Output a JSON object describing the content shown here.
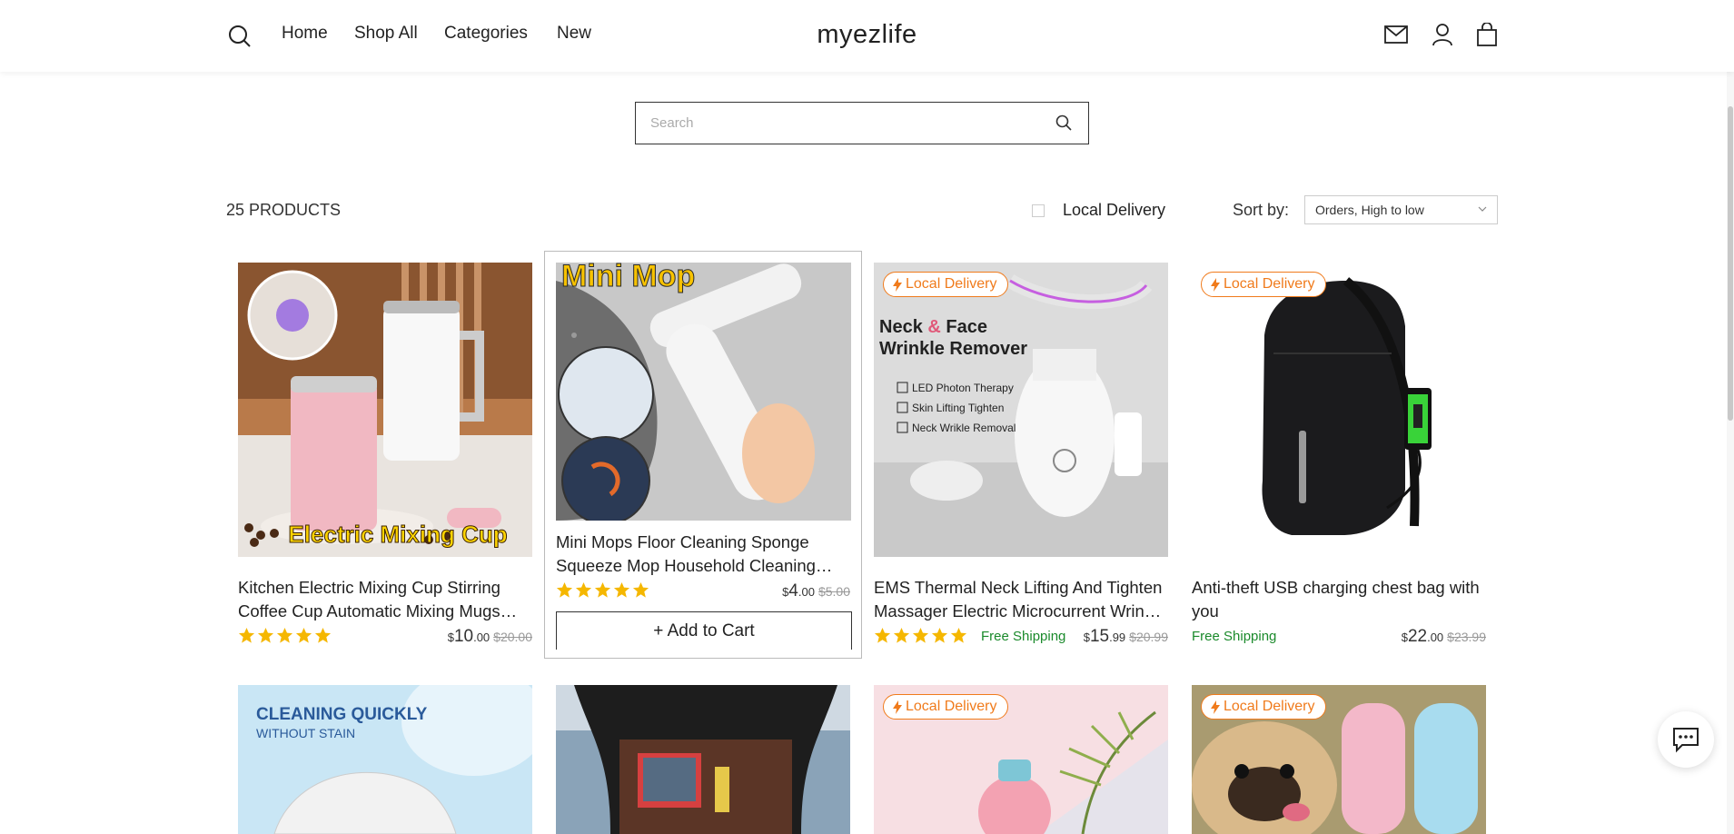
{
  "header": {
    "logo": "myezlife",
    "nav": [
      "Home",
      "Shop All",
      "Categories",
      "New"
    ],
    "icons": [
      "search-icon",
      "mail-icon",
      "account-icon",
      "bag-icon"
    ]
  },
  "search": {
    "placeholder": "Search"
  },
  "toolbar": {
    "product_count": "25 PRODUCTS",
    "local_delivery_label": "Local Delivery",
    "sort_label": "Sort by:",
    "sort_value": "Orders, High to low"
  },
  "products": [
    {
      "title": "Kitchen Electric Mixing Cup Stirring Coffee Cup Automatic Mixing Mugs Stainless Steel",
      "rating": 5,
      "currency": "$",
      "price_int": "10",
      "price_dec": ".00",
      "price_old": "$20.00",
      "badge": "",
      "free_shipping": "",
      "image_text": "Electric Mixing Cup"
    },
    {
      "title": "Mini Mops Floor Cleaning Sponge Squeeze Mop Household Cleaning Tools",
      "rating": 5,
      "currency": "$",
      "price_int": "4",
      "price_dec": ".00",
      "price_old": "$5.00",
      "badge": "",
      "free_shipping": "",
      "image_text": "Mini Mop",
      "add_to_cart": "+ Add to Cart"
    },
    {
      "title": "EMS Thermal Neck Lifting And Tighten Massager Electric Microcurrent Wrinkle Remover",
      "rating": 5,
      "currency": "$",
      "price_int": "15",
      "price_dec": ".99",
      "price_old": "$20.99",
      "badge": "Local Delivery",
      "free_shipping": "Free Shipping",
      "image_text": "Neck & Face Wrinkle Remover",
      "image_bullets": [
        "LED Photon Therapy",
        "Skin Lifting Tighten",
        "Neck Wrikle Removal"
      ]
    },
    {
      "title": "Anti-theft USB charging chest bag with you",
      "rating": 0,
      "currency": "$",
      "price_int": "22",
      "price_dec": ".00",
      "price_old": "$23.99",
      "badge": "Local Delivery",
      "free_shipping": "Free Shipping"
    },
    {
      "badge": "",
      "image_text_1": "CLEANING QUICKLY",
      "image_text_2": "WITHOUT STAIN"
    },
    {
      "badge": ""
    },
    {
      "badge": "Local Delivery"
    },
    {
      "badge": "Local Delivery"
    }
  ],
  "colors": {
    "badge_orange": "#f07b1c",
    "star_yellow": "#f5b700",
    "free_shipping_green": "#1a8a2b"
  },
  "chat": {
    "icon": "chat-icon"
  }
}
